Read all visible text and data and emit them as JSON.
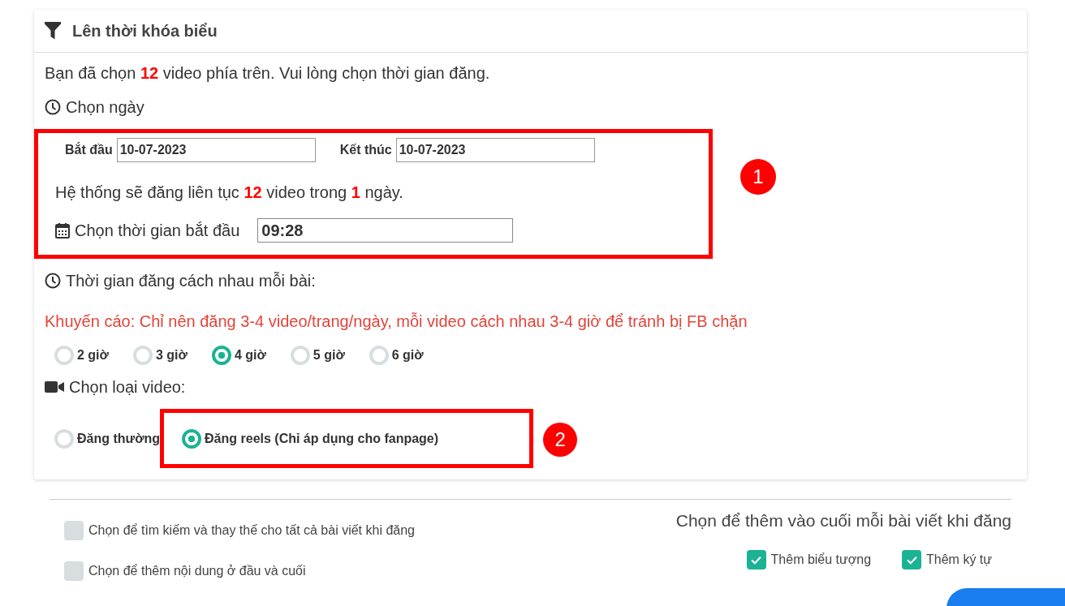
{
  "panel": {
    "title": "Lên thời khóa biểu",
    "intro": "Bạn đã chọn **12** video phía trên. Vui lòng chọn thời gian đăng.",
    "date_label": "Chọn ngày",
    "callout_1": {
      "label": "1",
      "start_label": "Bắt đầu",
      "start_value": "10-07-2023",
      "end_label": "Kết thúc",
      "end_value": "10-07-2023",
      "summary": "Hệ thống sẽ đăng liên tục **12** video trong **1** ngày.",
      "time_label": "Chọn thời gian bắt đầu",
      "time_value": "09:28"
    },
    "interval_label": "Thời gian đăng cách nhau mỗi bài:",
    "warning": "Khuyến cáo: Chỉ nên đăng 3-4 video/trang/ngày, mỗi video cách nhau 3-4 giờ để tránh bị FB chặn",
    "intervals": [
      {
        "label": "2 giờ",
        "selected": false
      },
      {
        "label": "3 giờ",
        "selected": false
      },
      {
        "label": "4 giờ",
        "selected": true
      },
      {
        "label": "5 giờ",
        "selected": false
      },
      {
        "label": "6 giờ",
        "selected": false
      }
    ],
    "type_label": "Chọn loại video:",
    "video_types": [
      {
        "label": "Đăng thường",
        "selected": false
      },
      {
        "label": "Đăng reels (Chỉ áp dụng cho fanpage)",
        "selected": true,
        "callout": "2"
      }
    ]
  },
  "options": {
    "left": [
      {
        "label": "Chọn để tìm kiếm và thay thế cho tất cả bài viết khi đăng",
        "checked": false
      },
      {
        "label": "Chọn để thêm nội dung ở đầu và cuối",
        "checked": false
      }
    ],
    "right_title": "Chọn để thêm vào cuối mỗi bài viết khi đăng",
    "right": [
      {
        "label": "Thêm biểu tượng",
        "checked": true
      },
      {
        "label": "Thêm ký tự",
        "checked": true
      }
    ]
  }
}
